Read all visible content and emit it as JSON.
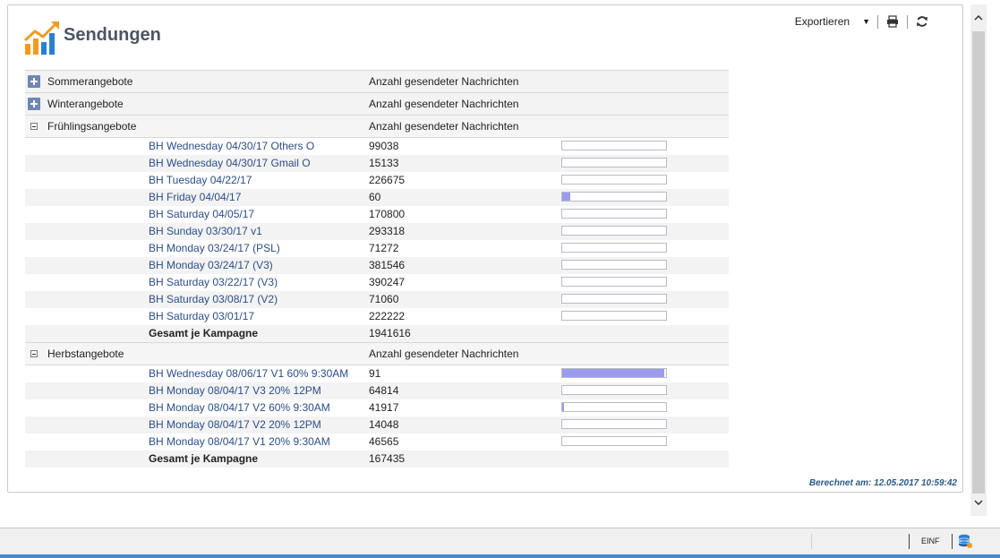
{
  "header": {
    "title": "Sendungen",
    "export_label": "Exportieren"
  },
  "groups_collapsed": [
    {
      "name": "Sommerangebote",
      "column": "Anzahl gesendeter Nachrichten"
    },
    {
      "name": "Winterangebote",
      "column": "Anzahl gesendeter Nachrichten"
    }
  ],
  "spring": {
    "name": "Frühlingsangebote",
    "column": "Anzahl gesendeter Nachrichten",
    "rows": [
      {
        "name": "BH Wednesday 04/30/17 Others O",
        "value": "99038",
        "bar": 0.0
      },
      {
        "name": "BH Wednesday 04/30/17 Gmail O",
        "value": "15133",
        "bar": 0.0
      },
      {
        "name": "BH Tuesday 04/22/17",
        "value": "226675",
        "bar": 0.0
      },
      {
        "name": "BH Friday 04/04/17",
        "value": "60",
        "bar": 0.08
      },
      {
        "name": "BH Saturday 04/05/17",
        "value": "170800",
        "bar": 0.0
      },
      {
        "name": "BH Sunday 03/30/17 v1",
        "value": "293318",
        "bar": 0.0
      },
      {
        "name": "BH Monday 03/24/17 (PSL)",
        "value": "71272",
        "bar": 0.0
      },
      {
        "name": "BH Monday 03/24/17 (V3)",
        "value": "381546",
        "bar": 0.0
      },
      {
        "name": "BH Saturday 03/22/17 (V3)",
        "value": "390247",
        "bar": 0.0
      },
      {
        "name": "BH Saturday 03/08/17 (V2)",
        "value": "71060",
        "bar": 0.0
      },
      {
        "name": "BH Saturday 03/01/17",
        "value": "222222",
        "bar": 0.0
      }
    ],
    "total_label": "Gesamt je Kampagne",
    "total_value": "1941616"
  },
  "autumn": {
    "name": "Herbstangebote",
    "column": "Anzahl gesendeter Nachrichten",
    "rows": [
      {
        "name": "BH Wednesday 08/06/17 V1 60% 9:30AM",
        "value": "91",
        "bar": 0.98
      },
      {
        "name": "BH Monday 08/04/17 V3 20% 12PM",
        "value": "64814",
        "bar": 0.0
      },
      {
        "name": "BH Monday 08/04/17 V2 60% 9:30AM",
        "value": "41917",
        "bar": 0.02
      },
      {
        "name": "BH Monday 08/04/17 V2 20% 12PM",
        "value": "14048",
        "bar": 0.0
      },
      {
        "name": "BH Monday 08/04/17 V1 20% 9:30AM",
        "value": "46565",
        "bar": 0.0
      }
    ],
    "total_label": "Gesamt je Kampagne",
    "total_value": "167435"
  },
  "footer": {
    "computed": "Berechnet am: 12.05.2017 10:59:42"
  },
  "statusbar": {
    "mode": "EINF"
  },
  "colors": {
    "accent": "#2a4d8c",
    "bar_fill": "#9b9bf0",
    "logo_orange": "#f39a1e",
    "logo_blue": "#2a7fd4"
  }
}
